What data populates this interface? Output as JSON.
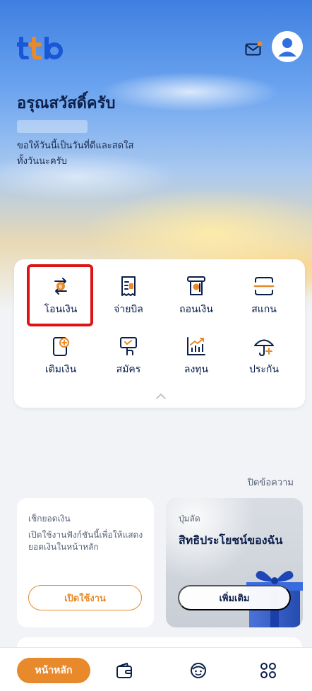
{
  "header": {
    "logo_text": "ttb",
    "logo_icon": "ttb-logo",
    "mail_icon": "mail-icon",
    "avatar_icon": "avatar-icon"
  },
  "hero": {
    "greeting": "อรุณสวัสดิ์ครับ",
    "wish": "ขอให้วันนี้เป็นวันที่ดีและสดใสทั้งวันนะครับ"
  },
  "menu": {
    "items": [
      {
        "label": "โอนเงิน",
        "icon": "transfer-icon"
      },
      {
        "label": "จ่ายบิล",
        "icon": "bill-icon"
      },
      {
        "label": "ถอนเงิน",
        "icon": "withdraw-icon"
      },
      {
        "label": "สแกน",
        "icon": "scan-icon"
      },
      {
        "label": "เติมเงิน",
        "icon": "topup-icon"
      },
      {
        "label": "สมัคร",
        "icon": "apply-icon"
      },
      {
        "label": "ลงทุน",
        "icon": "invest-icon"
      },
      {
        "label": "ประกัน",
        "icon": "insurance-icon"
      }
    ]
  },
  "dismiss_label": "ปิดข้อความ",
  "balance_card": {
    "title": "เช็กยอดเงิน",
    "description": "เปิดใช้งานฟังก์ชันนี้เพื่อให้แสดงยอดเงินในหน้าหลัก",
    "button": "เปิดใช้งาน"
  },
  "benefit_card": {
    "title": "ปุ่มลัด",
    "heading": "สิทธิประโยชน์ของฉัน",
    "button": "เพิ่มเติม"
  },
  "bottom_nav": {
    "home": "หน้าหลัก",
    "icons": [
      "wallet-icon",
      "support-icon",
      "apps-icon"
    ]
  },
  "colors": {
    "brand_navy": "#0b1f4a",
    "accent_orange": "#e8892c",
    "logo_blue": "#1a57d6",
    "highlight_red": "#e01313"
  }
}
